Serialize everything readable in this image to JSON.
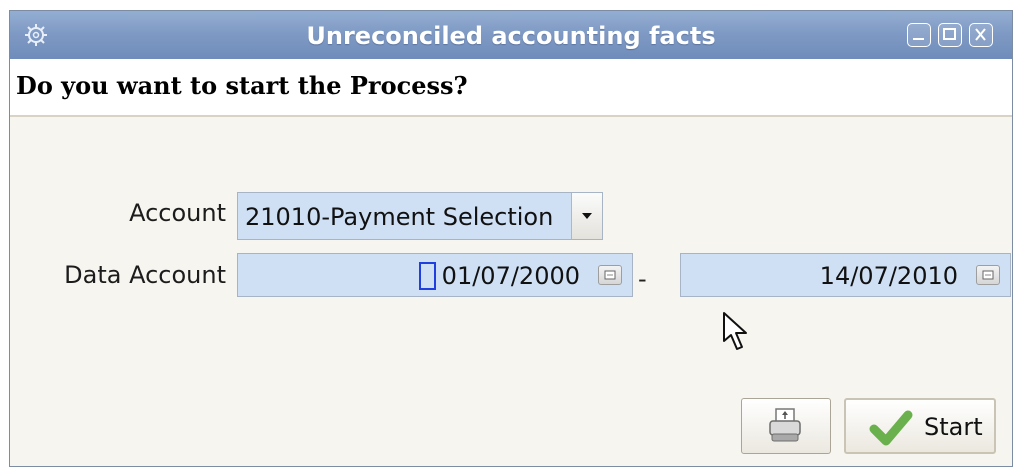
{
  "window": {
    "title": "Unreconciled accounting facts",
    "icon": "gear-icon",
    "controls": [
      "minimize-icon",
      "maximize-icon",
      "close-icon"
    ]
  },
  "prompt": {
    "text": "Do you want to start the Process?"
  },
  "form": {
    "account_label": "Account",
    "account_value": "21010-Payment Selection",
    "data_account_label": "Data Account",
    "date_from": "01/07/2000",
    "date_separator": "-",
    "date_to": "14/07/2010"
  },
  "buttons": {
    "print_icon": "printer-icon",
    "start_icon": "checkmark-icon",
    "start_label": "Start"
  },
  "colors": {
    "titlebar": "#7f9ac4",
    "field_background": "#cfe0f4",
    "window_background": "#f7f5ef",
    "checkmark": "#6ab04c"
  }
}
